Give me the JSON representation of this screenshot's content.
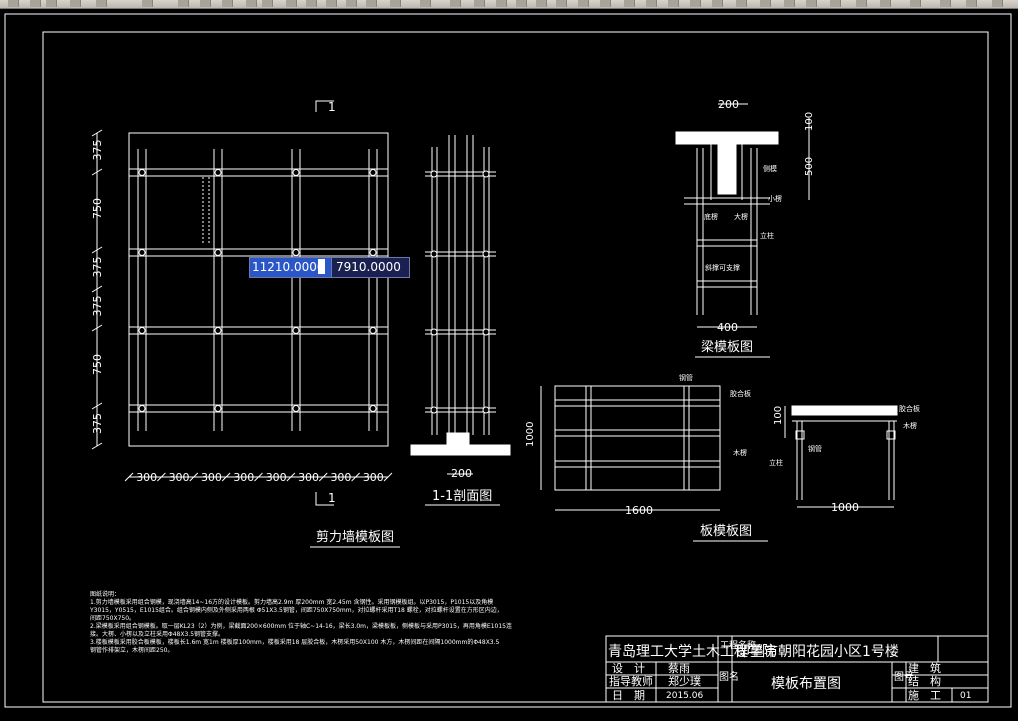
{
  "coords": {
    "x": "11210.0000",
    "y": "7910.0000"
  },
  "section_marks": [
    "1",
    "1"
  ],
  "wall": {
    "title": "剪力墙模板图",
    "dims_left": [
      "375",
      "750",
      "375",
      "375",
      "750",
      "375"
    ],
    "dims_bottom": [
      "300",
      "300",
      "300",
      "300",
      "300",
      "300",
      "300",
      "300"
    ]
  },
  "section": {
    "title": "1-1剖面图",
    "dim": "200"
  },
  "beam": {
    "title": "梁模板图",
    "dim_top": "200",
    "dims_right": [
      "100",
      "500"
    ],
    "dim_bottom": "400",
    "labels": [
      "侧模",
      "小楞",
      "底楞",
      "大楞",
      "立柱",
      "斜撑可支撑"
    ]
  },
  "slab": {
    "title": "板模板图",
    "dim_side": "1000",
    "dim_bottom": "1600",
    "labels": [
      "钢管",
      "胶合板",
      "木楞"
    ],
    "small_dims": [
      "100",
      "1000"
    ],
    "small_labels": [
      "胶合板",
      "木楞",
      "钢管",
      "立柱"
    ]
  },
  "notes": {
    "heading": "图纸说明：",
    "lines": [
      "1.剪力墙模板采用组合钢模，现浇墙高14~16方的设计模板。剪力墙高2.9m 厚200mm 宽2.45m 含钢性。采用钢模板组。以P3015，P1015以及角模",
      "Y3015，Y0515，E1015组合。组合钢模内侧及外侧采用两根 Φ51X3.5钢管，间距750X750mm，对拉螺杆采用T18 螺栓，对拉螺杆设置在方形区内边，",
      "间距750X750。",
      "2.梁模板采用组合钢模板。取一层KL23（2）为例，梁截面200×600mm 位于轴C~14-16，梁长3.0m，梁模板板，侧模板与采用P3015，再用角模E1015连",
      "接。大楞、小楞以及立柱采用Φ48X3.5钢管支撑。",
      "3.楼板模板采用胶合板模板，楼板长1.6m 宽1m 楼板厚100mm，楼板采用18 层胶合板，木楞采用50X100 木方，木楞间距在间隔1000mm的Φ48X3.5",
      "钢管作排架立，木楞间距250。"
    ]
  },
  "title_block": {
    "school": "青岛理工大学土木工程学院",
    "proj_label": "工程名称",
    "project": "即墨市朝阳花园小区1号楼",
    "rows": [
      {
        "label": "设　计",
        "value": "蔡雨"
      },
      {
        "label": "指导教师",
        "value": "郑少璞"
      },
      {
        "label": "日　期",
        "value": "2015.06"
      }
    ],
    "drawing_name_label": "图名",
    "drawing_name": "模板布置图",
    "number_label": "图号",
    "disciplines": [
      "建　筑",
      "结　构",
      "施　工"
    ],
    "sheet": "01"
  }
}
